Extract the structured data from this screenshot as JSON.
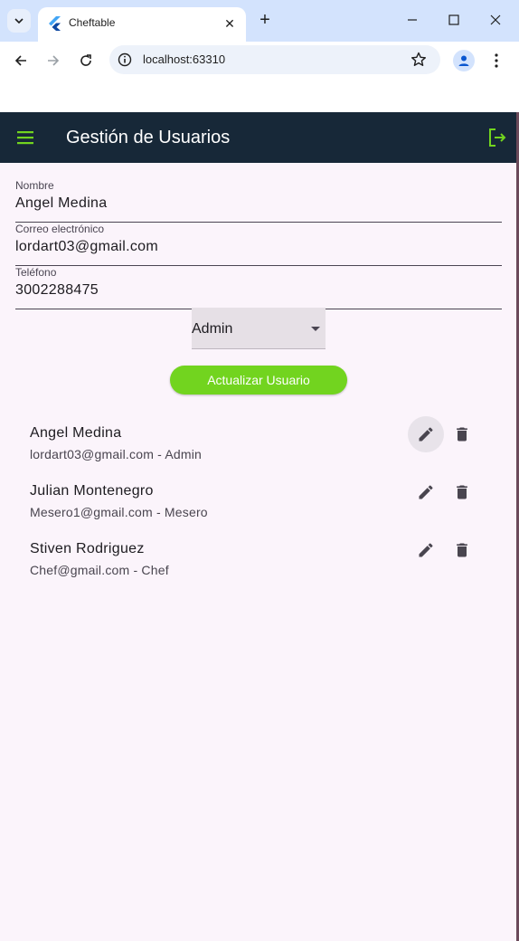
{
  "browser": {
    "tab_title": "Cheftable",
    "url": "localhost:63310"
  },
  "app": {
    "title": "Gestión de Usuarios",
    "accent": "#72d41f",
    "appbar_color": "#172838"
  },
  "form": {
    "name_label": "Nombre",
    "name_value": "Angel Medina",
    "email_label": "Correo electrónico",
    "email_value": "lordart03@gmail.com",
    "phone_label": "Teléfono",
    "phone_value": "3002288475",
    "role_value": "Admin",
    "submit_label": "Actualizar Usuario"
  },
  "users": [
    {
      "name": "Angel Medina",
      "subtitle": "lordart03@gmail.com - Admin"
    },
    {
      "name": "Julian Montenegro",
      "subtitle": "Mesero1@gmail.com - Mesero"
    },
    {
      "name": "Stiven Rodriguez",
      "subtitle": "Chef@gmail.com - Chef"
    }
  ],
  "icons": {
    "menu": "menu-icon",
    "logout": "logout-icon",
    "edit": "edit-icon",
    "delete": "delete-icon"
  }
}
